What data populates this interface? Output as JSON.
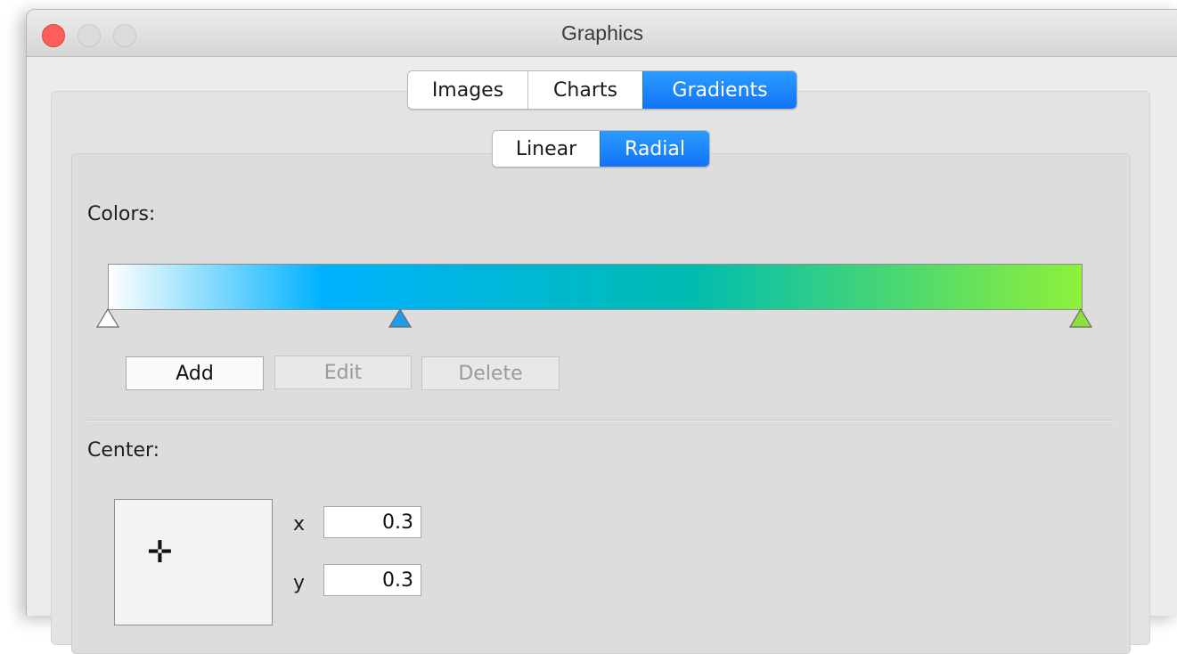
{
  "window": {
    "title": "Graphics"
  },
  "main_tabs": [
    {
      "label": "Images"
    },
    {
      "label": "Charts"
    },
    {
      "label": "Gradients",
      "active": true
    }
  ],
  "sub_tabs": [
    {
      "label": "Linear"
    },
    {
      "label": "Radial",
      "active": true
    }
  ],
  "colors_section": {
    "label": "Colors:",
    "stops": [
      {
        "position": 0.0,
        "color": "#ffffff"
      },
      {
        "position": 0.3,
        "color": "#1f9be8"
      },
      {
        "position": 1.0,
        "color": "#8ee03c"
      }
    ],
    "gradient_colors": [
      "#ffffff",
      "#00b2ff",
      "#00bcb0",
      "#8ef03a"
    ],
    "buttons": {
      "add": "Add",
      "edit": "Edit",
      "delete": "Delete"
    }
  },
  "center_section": {
    "label": "Center:",
    "x_label": "x",
    "x_value": "0.3",
    "y_label": "y",
    "y_value": "0.3"
  },
  "accent_color": "#1a7ff5"
}
